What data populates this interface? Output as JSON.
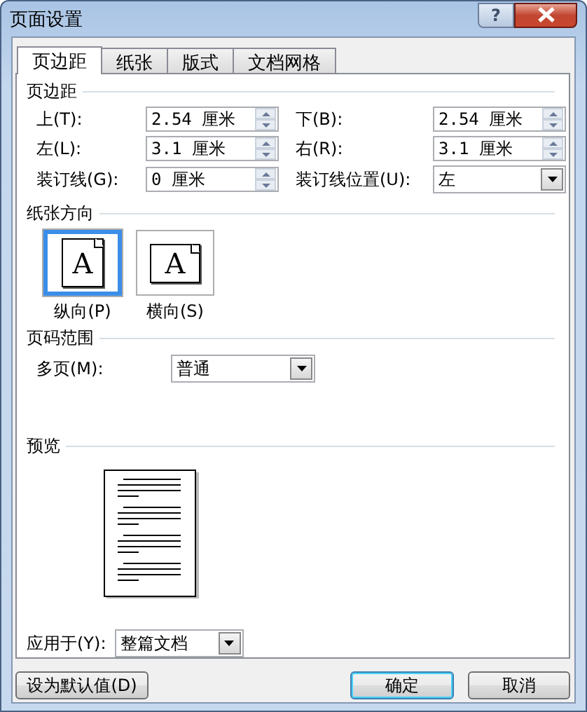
{
  "window": {
    "title": "页面设置",
    "help": "?"
  },
  "tabs": [
    {
      "label": "页边距",
      "selected": true
    },
    {
      "label": "纸张",
      "selected": false
    },
    {
      "label": "版式",
      "selected": false
    },
    {
      "label": "文档网格",
      "selected": false
    }
  ],
  "margins": {
    "title": "页边距",
    "fields": [
      {
        "label": "上(T):",
        "value": "2.54 厘米",
        "kind": "spin"
      },
      {
        "label": "下(B):",
        "value": "2.54 厘米",
        "kind": "spin"
      },
      {
        "label": "左(L):",
        "value": "3.1 厘米",
        "kind": "spin"
      },
      {
        "label": "右(R):",
        "value": "3.1 厘米",
        "kind": "spin"
      },
      {
        "label": "装订线(G):",
        "value": "0 厘米",
        "kind": "spin"
      },
      {
        "label": "装订线位置(U):",
        "value": "左",
        "kind": "dropdown"
      }
    ]
  },
  "orientation": {
    "title": "纸张方向",
    "options": [
      {
        "label": "纵向(P)",
        "glyph": "A",
        "selected": true
      },
      {
        "label": "横向(S)",
        "glyph": "A",
        "selected": false
      }
    ]
  },
  "pages": {
    "title": "页码范围",
    "label": "多页(M):",
    "value": "普通"
  },
  "preview": {
    "title": "预览"
  },
  "apply_to": {
    "label": "应用于(Y):",
    "value": "整篇文档"
  },
  "buttons": [
    {
      "label": "设为默认值(D)",
      "kind": "default"
    },
    {
      "label": "确定",
      "kind": "ok"
    },
    {
      "label": "取消",
      "kind": "cancel"
    }
  ]
}
